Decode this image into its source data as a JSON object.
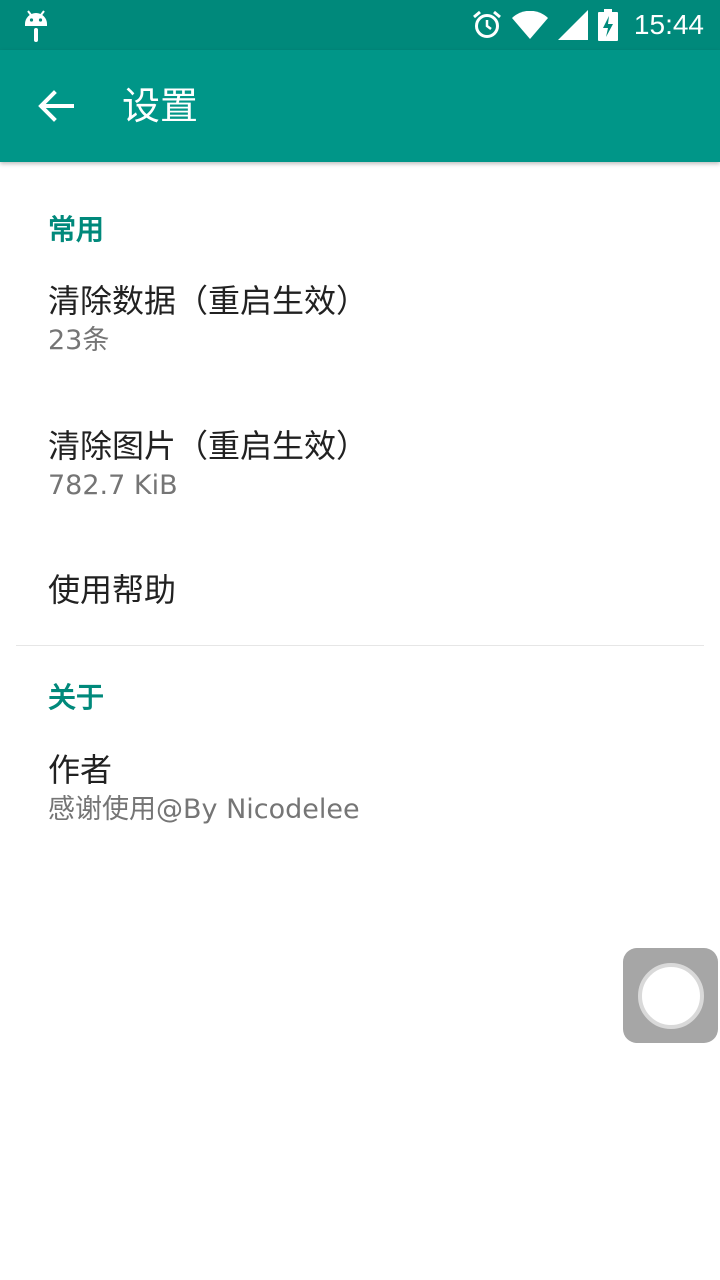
{
  "status_bar": {
    "time": "15:44",
    "icons": [
      "android-debug-icon",
      "alarm-icon",
      "wifi-icon",
      "cell-signal-icon",
      "battery-charging-icon"
    ]
  },
  "app_bar": {
    "title": "设置",
    "back_icon": "back-arrow-icon",
    "background": "#009688"
  },
  "sections": [
    {
      "header": "常用",
      "items": [
        {
          "title": "清除数据（重启生效）",
          "summary": "23条"
        },
        {
          "title": "清除图片（重启生效）",
          "summary": "782.7 KiB"
        },
        {
          "title": "使用帮助",
          "summary": ""
        }
      ]
    },
    {
      "header": "关于",
      "items": [
        {
          "title": "作者",
          "summary": "感谢使用@By Nicodelee"
        }
      ]
    }
  ],
  "colors": {
    "accent": "#00897b",
    "primary": "#009688",
    "title_text": "#212121",
    "summary_text": "#757575"
  }
}
